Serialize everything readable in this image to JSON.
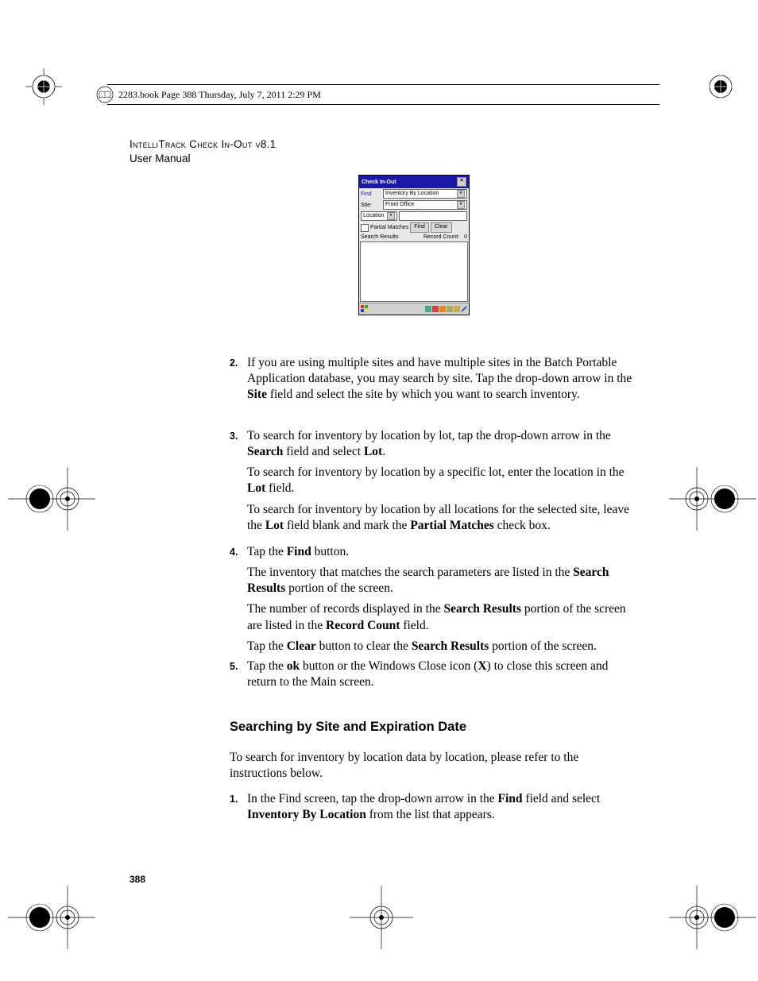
{
  "header": {
    "book_line": "2283.book  Page 388  Thursday, July 7, 2011  2:29 PM"
  },
  "doc": {
    "title_line1": "IntelliTrack Check In-Out v8.1",
    "title_line2": "User Manual"
  },
  "screenshot": {
    "title": "Check In-Out",
    "close": "×",
    "find_label": "Find",
    "find_value": "Inventory By Location",
    "site_label": "Site:",
    "site_value": "Front Office",
    "search_label": "Location",
    "search_value": "",
    "partial_label": "Partial Matches",
    "find_btn": "Find",
    "clear_btn": "Clear",
    "results_label": "Search Results",
    "record_count_label": "Record Count:",
    "record_count_value": "0"
  },
  "steps": {
    "s2": {
      "num": "2.",
      "p1a": "If you are using multiple sites and have multiple sites in the Batch Portable Application database, you may search by site. Tap the drop-down arrow in the ",
      "p1b": "Site",
      "p1c": " field and select the site by which you want to search inventory."
    },
    "s3": {
      "num": "3.",
      "p1a": "To search for inventory by location by lot, tap the drop-down arrow in the ",
      "p1b": "Search",
      "p1c": " field and select ",
      "p1d": "Lot",
      "p1e": ".",
      "p2a": "To search for inventory by location by a specific lot, enter the location in the ",
      "p2b": "Lot",
      "p2c": " field.",
      "p3a": "To search for inventory by location by all locations for the selected site, leave the ",
      "p3b": "Lot",
      "p3c": " field blank and mark the ",
      "p3d": "Partial Matches",
      "p3e": " check box."
    },
    "s4": {
      "num": "4.",
      "p1a": "Tap the ",
      "p1b": "Find",
      "p1c": " button.",
      "p2a": "The inventory that matches the search parameters are listed in the ",
      "p2b": "Search Results",
      "p2c": " portion of the screen.",
      "p3a": "The number of records displayed in the ",
      "p3b": "Search Results",
      "p3c": " portion of the screen are listed in the ",
      "p3d": "Record Count",
      "p3e": " field.",
      "p4a": "Tap the ",
      "p4b": "Clear",
      "p4c": " button to clear the ",
      "p4d": "Search Results",
      "p4e": " portion of the screen."
    },
    "s5": {
      "num": "5.",
      "p1a": "Tap the ",
      "p1b": "ok",
      "p1c": " button or the Windows Close icon (",
      "p1d": "X",
      "p1e": ") to close this screen and return to the Main screen."
    }
  },
  "section": {
    "head": "Searching by Site and Expiration Date",
    "intro": "To search for inventory by location data by location, please refer to the instructions below.",
    "s1": {
      "num": "1.",
      "p1a": "In the Find screen, tap the drop-down arrow in the ",
      "p1b": "Find",
      "p1c": " field and select ",
      "p1d": "Inventory By Location",
      "p1e": " from the list that appears."
    }
  },
  "page_number": "388"
}
